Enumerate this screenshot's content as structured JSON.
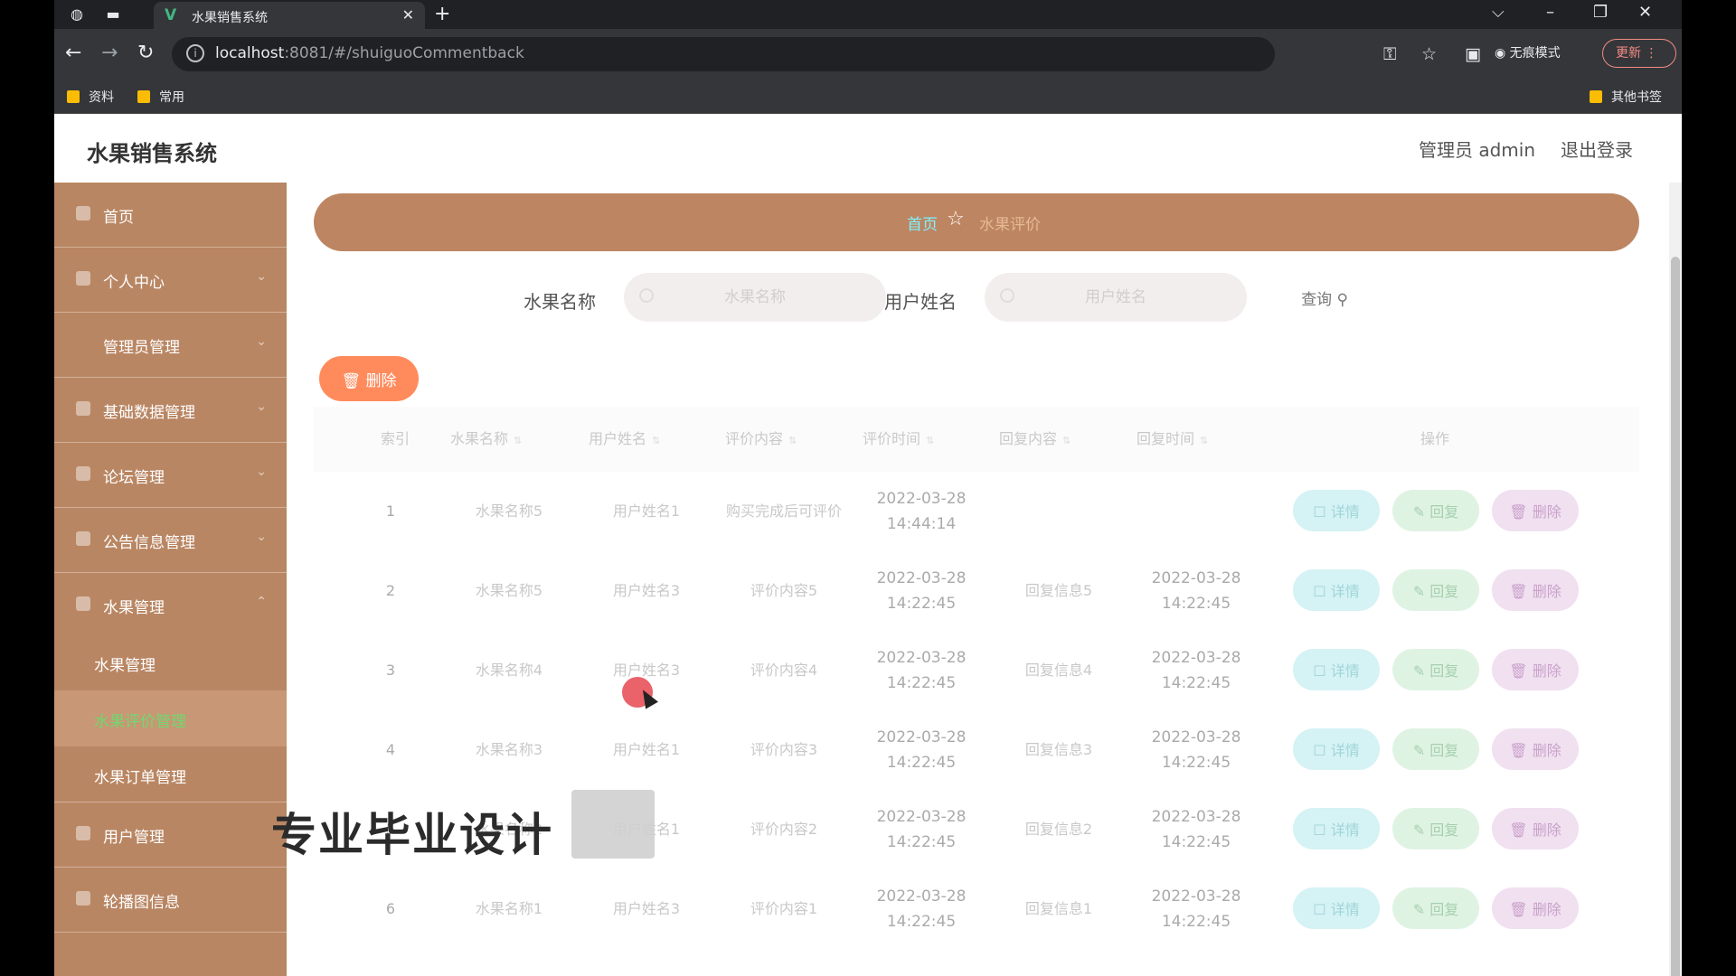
{
  "browser": {
    "tab_title": "水果销售系统",
    "tab_favicon": "vue-icon",
    "url_host": "localhost",
    "url_rest": ":8081/#/shuiguoCommentback",
    "incognito_label": "无痕模式",
    "update_label": "更新",
    "bookmarks": [
      "资料",
      "常用"
    ],
    "other_bookmarks": "其他书签"
  },
  "header": {
    "title": "水果销售系统",
    "user": "管理员 admin",
    "logout": "退出登录"
  },
  "sidebar": {
    "items": [
      {
        "label": "首页",
        "icon": "home-icon"
      },
      {
        "label": "个人中心",
        "icon": "user-icon"
      },
      {
        "label": "管理员管理",
        "icon": "admin-icon"
      },
      {
        "label": "基础数据管理",
        "icon": "data-icon"
      },
      {
        "label": "论坛管理",
        "icon": "forum-icon"
      },
      {
        "label": "公告信息管理",
        "icon": "notice-icon"
      },
      {
        "label": "水果管理",
        "icon": "fruit-icon"
      }
    ],
    "subitems": [
      "水果管理",
      "水果评价管理",
      "水果订单管理"
    ],
    "items_after": [
      {
        "label": "用户管理",
        "icon": "users-icon"
      },
      {
        "label": "轮播图信息",
        "icon": "carousel-icon"
      }
    ]
  },
  "breadcrumb": {
    "home": "首页",
    "current": "水果评价"
  },
  "search": {
    "fruit_label": "水果名称",
    "fruit_placeholder": "水果名称",
    "user_label": "用户姓名",
    "user_placeholder": "用户姓名",
    "query_label": "查询"
  },
  "toolbar": {
    "delete_label": "删除"
  },
  "table": {
    "headers": [
      "索引",
      "水果名称",
      "用户姓名",
      "评价内容",
      "评价时间",
      "回复内容",
      "回复时间",
      "操作"
    ],
    "rows": [
      {
        "index": "1",
        "fruit": "水果名称5",
        "user": "用户姓名1",
        "content": "购买完成后可评价",
        "time": "2022-03-28 14:44:14",
        "reply": "",
        "reply_time": ""
      },
      {
        "index": "2",
        "fruit": "水果名称5",
        "user": "用户姓名3",
        "content": "评价内容5",
        "time": "2022-03-28 14:22:45",
        "reply": "回复信息5",
        "reply_time": "2022-03-28 14:22:45"
      },
      {
        "index": "3",
        "fruit": "水果名称4",
        "user": "用户姓名3",
        "content": "评价内容4",
        "time": "2022-03-28 14:22:45",
        "reply": "回复信息4",
        "reply_time": "2022-03-28 14:22:45"
      },
      {
        "index": "4",
        "fruit": "水果名称3",
        "user": "用户姓名1",
        "content": "评价内容3",
        "time": "2022-03-28 14:22:45",
        "reply": "回复信息3",
        "reply_time": "2022-03-28 14:22:45"
      },
      {
        "index": "5",
        "fruit": "水果名称2",
        "user": "用户姓名1",
        "content": "评价内容2",
        "time": "2022-03-28 14:22:45",
        "reply": "回复信息2",
        "reply_time": "2022-03-28 14:22:45"
      },
      {
        "index": "6",
        "fruit": "水果名称1",
        "user": "用户姓名3",
        "content": "评价内容1",
        "time": "2022-03-28 14:22:45",
        "reply": "回复信息1",
        "reply_time": "2022-03-28 14:22:45"
      }
    ],
    "actions": {
      "detail": "详情",
      "reply": "回复",
      "delete": "删除"
    }
  },
  "overlay": {
    "watermark": "专业毕业设计"
  }
}
